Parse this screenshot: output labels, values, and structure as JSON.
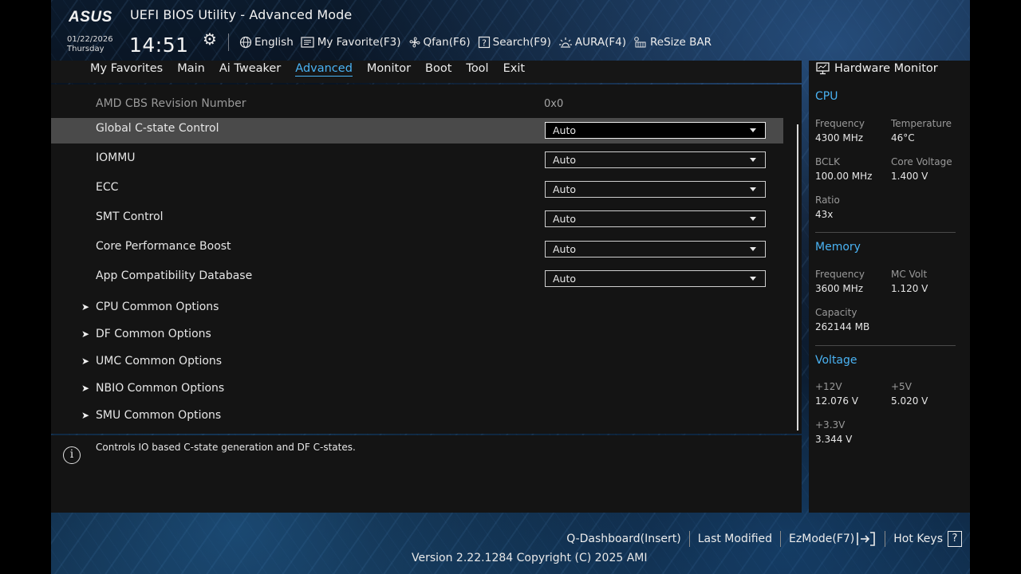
{
  "header": {
    "brand": "ASUS",
    "title": "UEFI BIOS Utility - Advanced Mode",
    "date": "01/22/2026",
    "day": "Thursday",
    "time": "14:51",
    "tools": [
      {
        "label": "English",
        "icon": "globe-icon"
      },
      {
        "label": "My Favorite(F3)",
        "icon": "favorite-icon"
      },
      {
        "label": "Qfan(F6)",
        "icon": "fan-icon"
      },
      {
        "label": "Search(F9)",
        "icon": "search-icon"
      },
      {
        "label": "AURA(F4)",
        "icon": "aura-icon"
      },
      {
        "label": "ReSize BAR",
        "icon": "resize-bar-icon"
      }
    ]
  },
  "tabs": [
    "My Favorites",
    "Main",
    "Ai Tweaker",
    "Advanced",
    "Monitor",
    "Boot",
    "Tool",
    "Exit"
  ],
  "active_tab": "Advanced",
  "settings": {
    "revision": {
      "label": "AMD CBS Revision Number",
      "value": "0x0"
    },
    "options": [
      {
        "label": "Global C-state Control",
        "value": "Auto",
        "selected": true
      },
      {
        "label": "IOMMU",
        "value": "Auto"
      },
      {
        "label": "ECC",
        "value": "Auto"
      },
      {
        "label": "SMT Control",
        "value": "Auto"
      },
      {
        "label": "Core Performance Boost",
        "value": "Auto"
      },
      {
        "label": "App Compatibility Database",
        "value": "Auto"
      }
    ],
    "submenus": [
      "CPU Common Options",
      "DF Common Options",
      "UMC Common Options",
      "NBIO Common Options",
      "SMU Common Options"
    ]
  },
  "help_text": "Controls IO based C-state generation and DF C-states.",
  "hardware_monitor": {
    "title": "Hardware Monitor",
    "cpu": {
      "title": "CPU",
      "frequency_label": "Frequency",
      "frequency": "4300 MHz",
      "temperature_label": "Temperature",
      "temperature": "46°C",
      "bclk_label": "BCLK",
      "bclk": "100.00 MHz",
      "core_voltage_label": "Core Voltage",
      "core_voltage": "1.400 V",
      "ratio_label": "Ratio",
      "ratio": "43x"
    },
    "memory": {
      "title": "Memory",
      "frequency_label": "Frequency",
      "frequency": "3600 MHz",
      "mc_volt_label": "MC Volt",
      "mc_volt": "1.120 V",
      "capacity_label": "Capacity",
      "capacity": "262144 MB"
    },
    "voltage": {
      "title": "Voltage",
      "v12_label": "+12V",
      "v12": "12.076 V",
      "v5_label": "+5V",
      "v5": "5.020 V",
      "v33_label": "+3.3V",
      "v33": "3.344 V"
    }
  },
  "footer": {
    "q_dashboard": "Q-Dashboard(Insert)",
    "last_modified": "Last Modified",
    "ezmode": "EzMode(F7)",
    "hot_keys": "Hot Keys",
    "hot_keys_icon": "?",
    "version": "Version 2.22.1284 Copyright (C) 2025 AMI"
  },
  "colors": {
    "accent": "#4ab3f4",
    "panel": "#141414",
    "selected_row": "#4a4a4a"
  }
}
